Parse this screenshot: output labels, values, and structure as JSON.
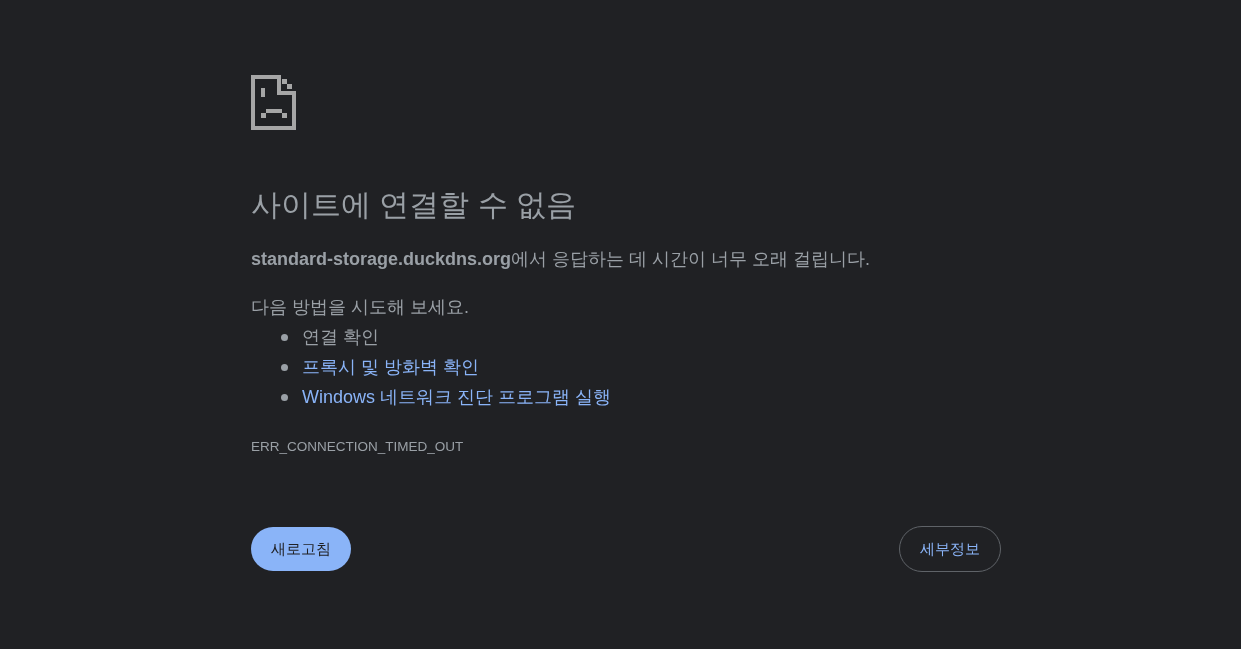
{
  "heading": "사이트에 연결할 수 없음",
  "message": "**standard-storage.duckdns.org**에서 응답하는 데 시간이 너무 오래 걸립니다.",
  "suggestions_intro": "다음 방법을 시도해 보세요.",
  "suggestions": [
    {
      "text": "연결 확인",
      "kind": "text"
    },
    {
      "text": "프록시 및 방화벽 확인",
      "kind": "link"
    },
    {
      "text": "Windows 네트워크 진단 프로그램 실행",
      "kind": "link"
    }
  ],
  "error_code": "ERR_CONNECTION_TIMED_OUT",
  "buttons": [
    {
      "label": "새로고침",
      "kind": "primary"
    },
    {
      "label": "세부정보",
      "kind": "outline"
    }
  ]
}
